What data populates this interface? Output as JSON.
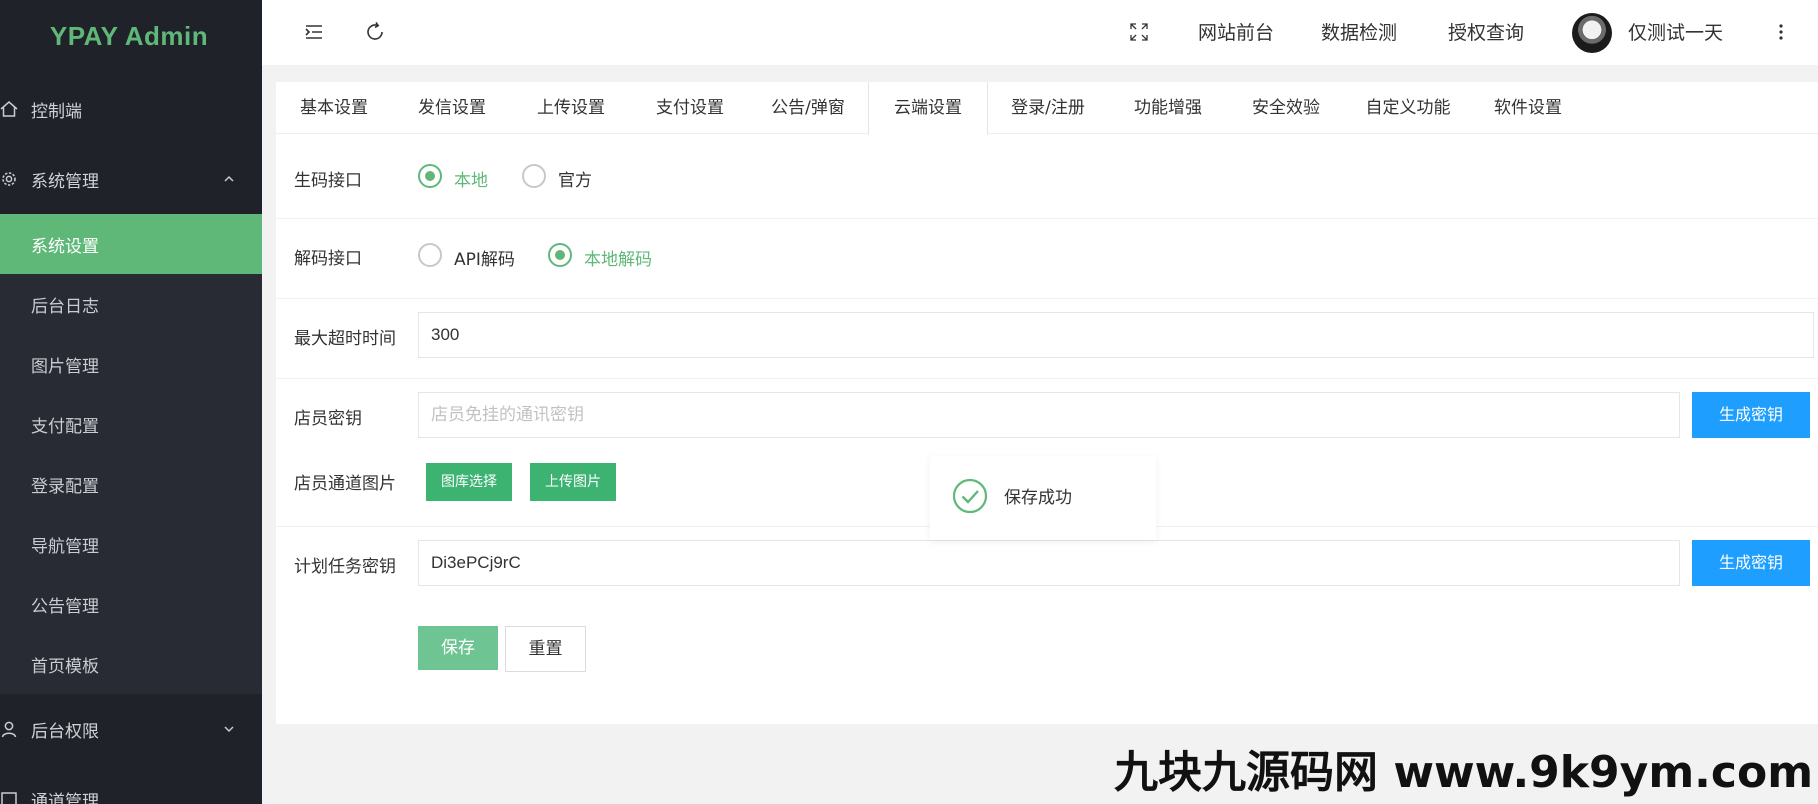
{
  "app": {
    "title": "YPAY Admin"
  },
  "sidebar": {
    "dashboard": "控制端",
    "system_group": "系统管理",
    "system_items": [
      "系统设置",
      "后台日志",
      "图片管理",
      "支付配置",
      "登录配置",
      "导航管理",
      "公告管理",
      "首页模板"
    ],
    "active_item": "系统设置",
    "permissions_group": "后台权限",
    "partial_group": "通道管理"
  },
  "header": {
    "links": [
      "网站前台",
      "数据检测",
      "授权查询"
    ],
    "username": "仅测试一天"
  },
  "tabs": [
    "基本设置",
    "发信设置",
    "上传设置",
    "支付设置",
    "公告/弹窗",
    "云端设置",
    "登录/注册",
    "功能增强",
    "安全效验",
    "自定义功能",
    "软件设置"
  ],
  "active_tab": "云端设置",
  "form": {
    "code_api": {
      "label": "生码接口",
      "options": [
        "本地",
        "官方"
      ],
      "selected": "本地"
    },
    "decode_api": {
      "label": "解码接口",
      "options": [
        "API解码",
        "本地解码"
      ],
      "selected": "本地解码"
    },
    "timeout": {
      "label": "最大超时时间",
      "value": "300"
    },
    "clerk_key": {
      "label": "店员密钥",
      "placeholder": "店员免挂的通讯密钥",
      "button": "生成密钥"
    },
    "clerk_image": {
      "label": "店员通道图片",
      "gallery_button": "图库选择",
      "upload_button": "上传图片"
    },
    "cron_key": {
      "label": "计划任务密钥",
      "value": "Di3ePCj9rC",
      "button": "生成密钥"
    },
    "save_button": "保存",
    "reset_button": "重置"
  },
  "toast": {
    "message": "保存成功"
  },
  "watermark": "九块九源码网 www.9k9ym.com",
  "colors": {
    "sidebar_bg": "#20222a",
    "active_green": "#5fb878",
    "primary_blue": "#1e9fff",
    "logo": "#009688"
  }
}
